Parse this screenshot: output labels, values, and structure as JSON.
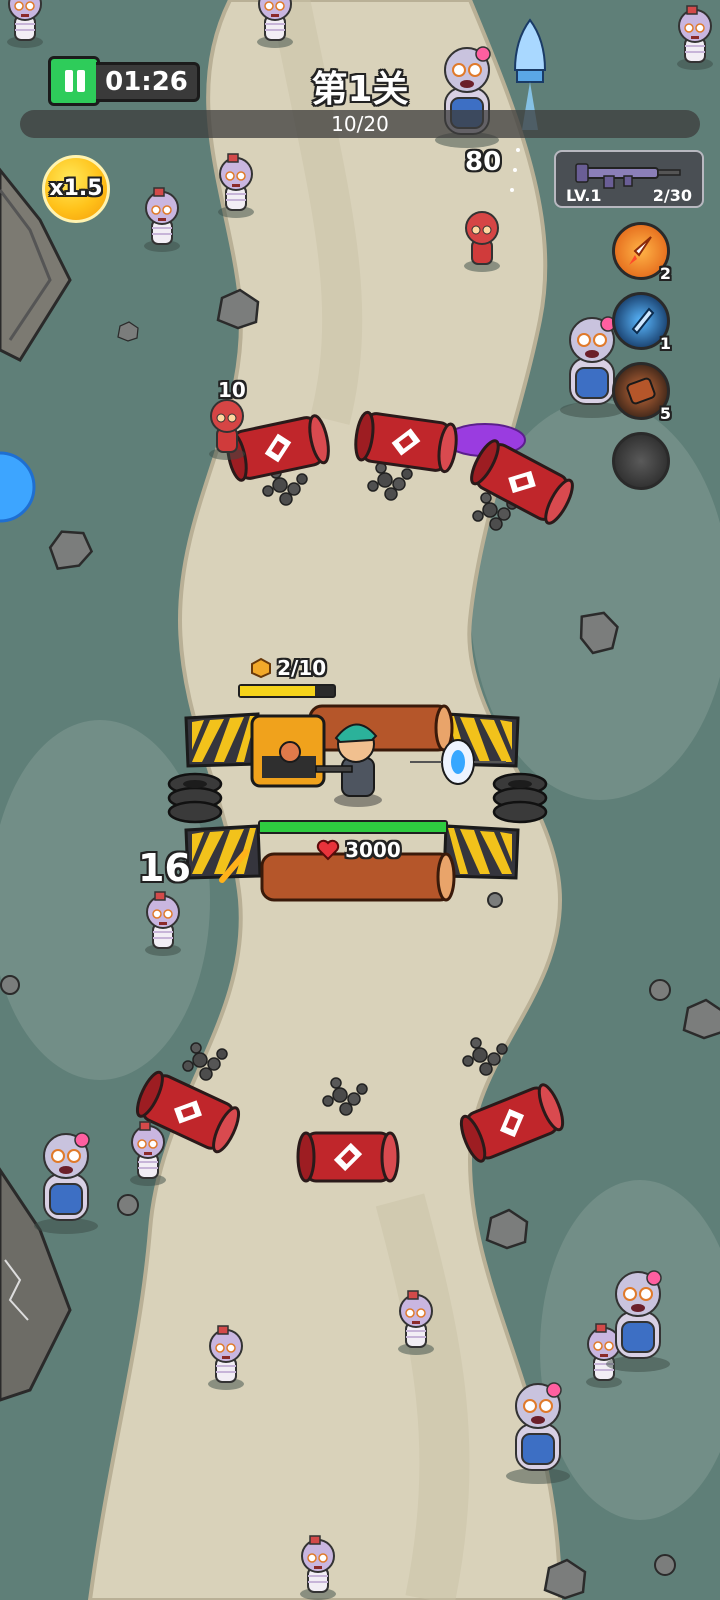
{
  "hud": {
    "timer": "01:26",
    "level_title": "第1关",
    "wave_progress_text": "10/20",
    "wave_progress_fraction": 0.5,
    "speed_multiplier": "x1.5",
    "score_popup": "80"
  },
  "weapon": {
    "level": "LV.1",
    "ammo": "2/30",
    "icon": "rifle-icon"
  },
  "skills": [
    {
      "name": "rocket-skill",
      "icon": "rocket-icon",
      "count": "2"
    },
    {
      "name": "missile-skill",
      "icon": "missile-icon",
      "count": "1"
    },
    {
      "name": "barrel-skill",
      "icon": "barrel-icon",
      "count": "5"
    },
    {
      "name": "empty-skill",
      "icon": "empty-slot-icon",
      "count": ""
    }
  ],
  "base": {
    "resource": "2/10",
    "resource_fraction": 0.8,
    "health": "3000",
    "health_fraction": 1.0
  },
  "damage_popups": {
    "red_zombie_hit": "10",
    "left_zombie_hit": "16"
  },
  "colors": {
    "ground": "#5f7f78",
    "road": "#d9d2ba",
    "pause_green": "#2ecc5a",
    "health_green": "#2ecc40",
    "resource_yellow": "#f5d31a",
    "barrel_red": "#c0262b"
  }
}
